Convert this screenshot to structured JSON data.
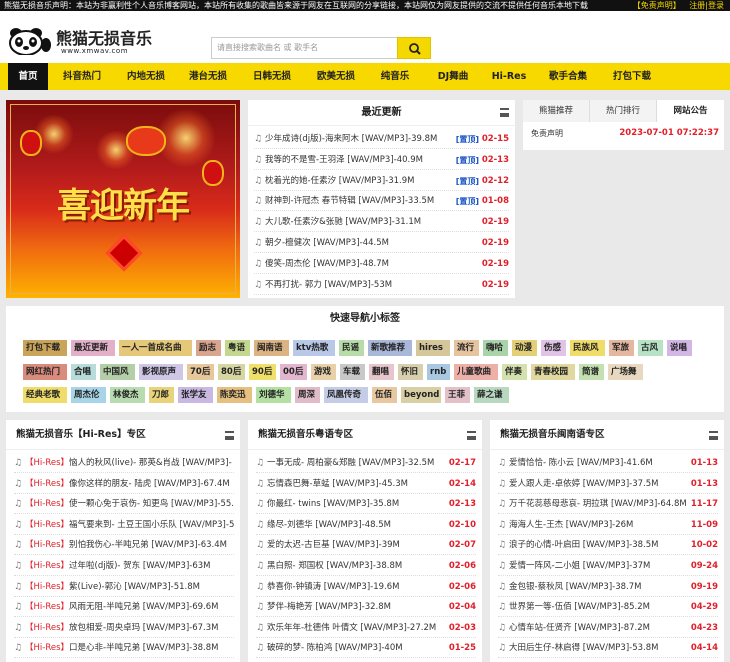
{
  "topbar": {
    "notice": "熊猫无损音乐声明：本站为非赢利性个人音乐博客网站，本站所有收集的歌曲皆来源于网友在互联网的分享链接，本站网仅为网友提供的交流不提供任何音乐本地下载",
    "disclaimer_link": "【免责声明】",
    "login_link": "注册|登录"
  },
  "logo": {
    "name": "熊猫无损音乐",
    "url": "www.xmwav.com"
  },
  "search": {
    "placeholder": "请直接搜索歌曲名 或 歌手名"
  },
  "nav": [
    "首页",
    "抖音热门",
    "内地无损",
    "港台无损",
    "日韩无损",
    "欧美无损",
    "纯音乐",
    "DJ舞曲",
    "Hi-Res",
    "歌手合集",
    "打包下载"
  ],
  "banner": {
    "text": "喜迎新年"
  },
  "latest": {
    "title": "最近更新",
    "items": [
      {
        "title": "少年成诗(dj版)-海来阿木 [WAV/MP3]-39.8M",
        "tag": "[置顶]",
        "date": "02-15"
      },
      {
        "title": "我等的不是雪-王羽泽 [WAV/MP3]-40.9M",
        "tag": "[置顶]",
        "date": "02-13"
      },
      {
        "title": "枕着光的她-任素汐 [WAV/MP3]-31.9M",
        "tag": "[置顶]",
        "date": "02-12"
      },
      {
        "title": "财神到-许冠杰 春节特辑 [WAV/MP3]-33.5M",
        "tag": "[置顶]",
        "date": "01-08"
      },
      {
        "title": "大儿歌-任素汐&张驰 [WAV/MP3]-31.1M",
        "tag": "",
        "date": "02-19"
      },
      {
        "title": "朝夕-檀健次 [WAV/MP3]-44.5M",
        "tag": "",
        "date": "02-19"
      },
      {
        "title": "傻笑-周杰伦 [WAV/MP3]-48.7M",
        "tag": "",
        "date": "02-19"
      },
      {
        "title": "不再打扰- 郭力 [WAV/MP3]-53M",
        "tag": "",
        "date": "02-19"
      }
    ]
  },
  "notice_panel": {
    "tabs": [
      "熊猫推荐",
      "热门排行",
      "网站公告"
    ],
    "item": "免责声明",
    "date": "2023-07-01 07:22:37"
  },
  "quick": {
    "title": "快速导航小标签",
    "tags": [
      {
        "label": "打包下载",
        "color": "#c9a45a"
      },
      {
        "label": "最近更新",
        "color": "#e2b0c8"
      },
      {
        "label": "一人一首成名曲",
        "color": "#e5c87a"
      },
      {
        "label": "励志",
        "color": "#d9a58e"
      },
      {
        "label": "粤语",
        "color": "#c3d88e"
      },
      {
        "label": "闽南语",
        "color": "#dcb484"
      },
      {
        "label": "ktv热歌",
        "color": "#b9c8e8"
      },
      {
        "label": "民谣",
        "color": "#b7dca7"
      },
      {
        "label": "新歌推荐",
        "color": "#a9b7d8"
      },
      {
        "label": "hires",
        "color": "#d6c79a"
      },
      {
        "label": "流行",
        "color": "#e6c4a0"
      },
      {
        "label": "嗨哈",
        "color": "#a9d4a9"
      },
      {
        "label": "动漫",
        "color": "#e3cf78"
      },
      {
        "label": "伤感",
        "color": "#e0c3e6"
      },
      {
        "label": "民族风",
        "color": "#f0dc6a"
      },
      {
        "label": "军旅",
        "color": "#e4b8a0"
      },
      {
        "label": "古风",
        "color": "#b8e2c4"
      },
      {
        "label": "说唱",
        "color": "#d2b7e6"
      },
      {
        "label": "网红热门",
        "color": "#d98c7c"
      },
      {
        "label": "合唱",
        "color": "#b7dcd9"
      },
      {
        "label": "中国风",
        "color": "#b4cfa8"
      },
      {
        "label": "影视原声",
        "color": "#cfc7e6"
      },
      {
        "label": "70后",
        "color": "#e6c89a"
      },
      {
        "label": "80后",
        "color": "#d6d6a2"
      },
      {
        "label": "90后",
        "color": "#f0e06a"
      },
      {
        "label": "00后",
        "color": "#e3b6cf"
      },
      {
        "label": "游戏",
        "color": "#e8d0a8"
      },
      {
        "label": "车载",
        "color": "#c8c8c8"
      },
      {
        "label": "翻唱",
        "color": "#e6c6cc"
      },
      {
        "label": "怀旧",
        "color": "#d8cfae"
      },
      {
        "label": "rnb",
        "color": "#a8c8e2"
      },
      {
        "label": "儿童歌曲",
        "color": "#ecb0a8"
      },
      {
        "label": "伴奏",
        "color": "#d4e0ae"
      },
      {
        "label": "青春校园",
        "color": "#e0d89e"
      },
      {
        "label": "简谱",
        "color": "#c4e0b0"
      },
      {
        "label": "广场舞",
        "color": "#e8d8c0"
      },
      {
        "label": "经典老歌",
        "color": "#f0dc6a"
      },
      {
        "label": "周杰伦",
        "color": "#a8d4e8"
      },
      {
        "label": "林俊杰",
        "color": "#b8dcb0"
      },
      {
        "label": "刀郎",
        "color": "#e8d27a"
      },
      {
        "label": "张学友",
        "color": "#c8b8e2"
      },
      {
        "label": "陈奕迅",
        "color": "#e6c080"
      },
      {
        "label": "刘德华",
        "color": "#b4e0a4"
      },
      {
        "label": "周深",
        "color": "#e0bcc8"
      },
      {
        "label": "凤凰传奇",
        "color": "#c4cce6"
      },
      {
        "label": "伍佰",
        "color": "#e8c8a0"
      },
      {
        "label": "beyond",
        "color": "#d8d0a4"
      },
      {
        "label": "王菲",
        "color": "#e4c0c8"
      },
      {
        "label": "薛之谦",
        "color": "#b8d8c0"
      }
    ]
  },
  "hires": {
    "title": "熊猫无损音乐【Hi-Res】专区",
    "items": [
      {
        "tag": "【Hi-Res】",
        "title": "恼人的秋风(live)- 那英&肖战 [WAV/MP3]-"
      },
      {
        "tag": "【Hi-Res】",
        "title": "像你这样的朋友- 陆虎 [WAV/MP3]-67.4M"
      },
      {
        "tag": "【Hi-Res】",
        "title": "使一颗心免于哀伤- 知更鸟 [WAV/MP3]-55."
      },
      {
        "tag": "【Hi-Res】",
        "title": "福气要来到- 土豆王国小乐队 [WAV/MP3]-5"
      },
      {
        "tag": "【Hi-Res】",
        "title": "别怕我伤心-半吨兄弟 [WAV/MP3]-63.4M"
      },
      {
        "tag": "【Hi-Res】",
        "title": "过年啦(dj版)- 贺东 [WAV/MP3]-63M"
      },
      {
        "tag": "【Hi-Res】",
        "title": "紫(Live)-郭沁 [WAV/MP3]-51.8M"
      },
      {
        "tag": "【Hi-Res】",
        "title": "风雨无阻-半吨兄弟 [WAV/MP3]-69.6M"
      },
      {
        "tag": "【Hi-Res】",
        "title": "放包相爱-周央卓玛 [WAV/MP3]-67.3M"
      },
      {
        "tag": "【Hi-Res】",
        "title": "口是心非-半吨兄弟 [WAV/MP3]-38.8M"
      }
    ]
  },
  "cantonese": {
    "title": "熊猫无损音乐粤语专区",
    "items": [
      {
        "title": "一事无成- 周柏豪&郑融 [WAV/MP3]-32.5M",
        "date": "02-17"
      },
      {
        "title": "忘情森巴舞-草蜢 [WAV/MP3]-45.3M",
        "date": "02-14"
      },
      {
        "title": "你最红- twins [WAV/MP3]-35.8M",
        "date": "02-13"
      },
      {
        "title": "缘尽-刘德华 [WAV/MP3]-48.5M",
        "date": "02-10"
      },
      {
        "title": "爱的太迟-古巨基 [WAV/MP3]-39M",
        "date": "02-07"
      },
      {
        "title": "黑白照- 郑国权 [WAV/MP3]-38.8M",
        "date": "02-06"
      },
      {
        "title": "恭喜你-钟镇涛 [WAV/MP3]-19.6M",
        "date": "02-06"
      },
      {
        "title": "梦伴-梅艳芳 [WAV/MP3]-32.8M",
        "date": "02-04"
      },
      {
        "title": "欢乐年年-杜德伟 叶倩文 [WAV/MP3]-27.2M",
        "date": "02-03"
      },
      {
        "title": "破碎的梦- 陈柏鸿 [WAV/MP3]-40M",
        "date": "01-25"
      }
    ]
  },
  "minnan": {
    "title": "熊猫无损音乐闽南语专区",
    "items": [
      {
        "title": "爱情恰恰- 陈小云 [WAV/MP3]-41.6M",
        "date": "01-13"
      },
      {
        "title": "爱人跟人走-卓依婷 [WAV/MP3]-37.5M",
        "date": "01-13"
      },
      {
        "title": "万千花蕊慈母悲哀- 玥拉琪 [WAV/MP3]-64.8M",
        "date": "11-17"
      },
      {
        "title": "海海人生-王杰 [WAV/MP3]-26M",
        "date": "11-09"
      },
      {
        "title": "浪子的心情-叶启田 [WAV/MP3]-38.5M",
        "date": "10-02"
      },
      {
        "title": "爱情一阵风-二小姐 [WAV/MP3]-37M",
        "date": "09-24"
      },
      {
        "title": "金包银-蔡秋凤 [WAV/MP3]-38.7M",
        "date": "09-19"
      },
      {
        "title": "世界第一等-伍佰 [WAV/MP3]-85.2M",
        "date": "04-29"
      },
      {
        "title": "心情车站-任贤齐 [WAV/MP3]-87.2M",
        "date": "04-23"
      },
      {
        "title": "大田后生仔-林启得 [WAV/MP3]-53.8M",
        "date": "04-14"
      }
    ]
  }
}
